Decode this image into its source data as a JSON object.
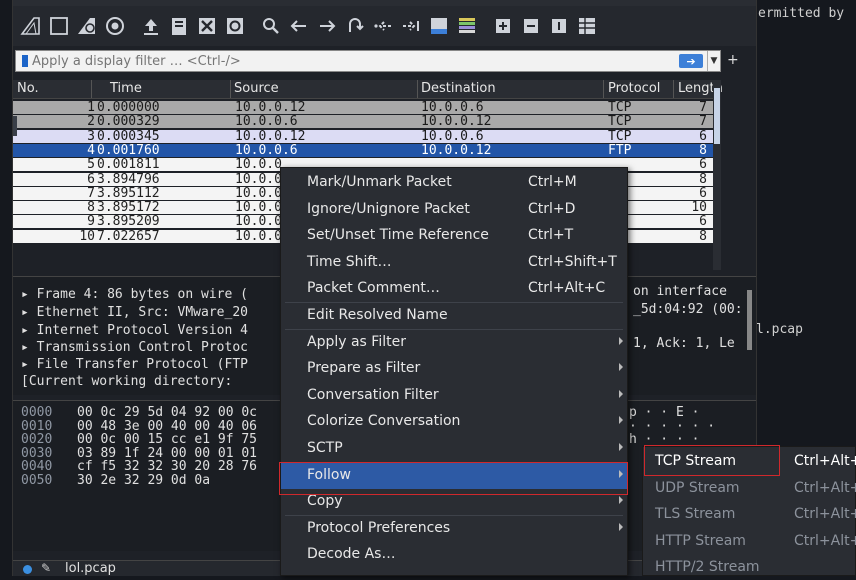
{
  "window": {
    "file_name": "lol.pcap"
  },
  "background_text": {
    "right_top": "ermitted by",
    "right_mid": "l.pcap"
  },
  "toolbar": {
    "icons": [
      "shark-fin-icon",
      "stop-icon",
      "restart-icon",
      "options-gear-icon",
      "open-file-icon",
      "save-file-icon",
      "close-file-icon",
      "reload-icon",
      "search-icon",
      "back-arrow-icon",
      "forward-arrow-icon",
      "go-to-packet-icon",
      "first-packet-icon",
      "last-packet-icon",
      "autoscroll-icon",
      "colorize-icon",
      "zoom-in-icon",
      "zoom-out-icon",
      "normal-size-icon",
      "resize-columns-icon"
    ]
  },
  "filter": {
    "placeholder": "Apply a display filter … <Ctrl-/>"
  },
  "columns": {
    "no": "No.",
    "time": "Time",
    "source": "Source",
    "destination": "Destination",
    "protocol": "Protocol",
    "length": "Length"
  },
  "packets": [
    {
      "no": "1",
      "time": "0.000000",
      "src": "10.0.0.12",
      "dst": "10.0.0.6",
      "proto": "TCP",
      "len": "7",
      "style": "gray"
    },
    {
      "no": "2",
      "time": "0.000329",
      "src": "10.0.0.6",
      "dst": "10.0.0.12",
      "proto": "TCP",
      "len": "7",
      "style": "gray"
    },
    {
      "no": "3",
      "time": "0.000345",
      "src": "10.0.0.12",
      "dst": "10.0.0.6",
      "proto": "TCP",
      "len": "6",
      "style": "lav"
    },
    {
      "no": "4",
      "time": "0.001760",
      "src": "10.0.0.6",
      "dst": "10.0.0.12",
      "proto": "FTP",
      "len": "8",
      "style": "sel"
    },
    {
      "no": "5",
      "time": "0.001811",
      "src": "10.0.0",
      "dst": "",
      "proto": "",
      "len": "6",
      "style": "plain"
    },
    {
      "no": "6",
      "time": "3.894796",
      "src": "10.0.0",
      "dst": "",
      "proto": "",
      "len": "8",
      "style": "plain"
    },
    {
      "no": "7",
      "time": "3.895112",
      "src": "10.0.0",
      "dst": "",
      "proto": "",
      "len": "6",
      "style": "plain"
    },
    {
      "no": "8",
      "time": "3.895172",
      "src": "10.0.0",
      "dst": "",
      "proto": "",
      "len": "10",
      "style": "plain"
    },
    {
      "no": "9",
      "time": "3.895209",
      "src": "10.0.0",
      "dst": "",
      "proto": "",
      "len": "6",
      "style": "plain"
    },
    {
      "no": "10",
      "time": "7.022657",
      "src": "10.0.0",
      "dst": "",
      "proto": "",
      "len": "8",
      "style": "plain"
    }
  ],
  "details": {
    "lines": [
      "▸ Frame 4: 86 bytes on wire (",
      "▸ Ethernet II, Src: VMware_20",
      "▸ Internet Protocol Version 4",
      "▸ Transmission Control Protoc",
      "▸ File Transfer Protocol (FTP",
      "  [Current working directory:"
    ],
    "right": [
      "on interface",
      "_5d:04:92 (00:",
      "",
      "1, Ack: 1, Le"
    ]
  },
  "hex": {
    "offsets": [
      "0000",
      "0010",
      "0020",
      "0030",
      "0040",
      "0050"
    ],
    "bytes": [
      "00 0c 29 5d 04 92 00 0c",
      "00 48 3e 00 40 00 40 06",
      "00 0c 00 15 cc e1 9f 75",
      "03 89 1f 24 00 00 01 01",
      "cf f5 32 32 30 20 28 76",
      "30 2e 32 29 0d 0a"
    ],
    "ascii": [
      "p · · E ·",
      "· · · · · ·",
      "h · · · ·"
    ]
  },
  "context_menu": {
    "items": [
      {
        "label": "Mark/Unmark Packet",
        "shortcut": "Ctrl+M",
        "submenu": false
      },
      {
        "label": "Ignore/Unignore Packet",
        "shortcut": "Ctrl+D",
        "submenu": false
      },
      {
        "label": "Set/Unset Time Reference",
        "shortcut": "Ctrl+T",
        "submenu": false
      },
      {
        "label": "Time Shift…",
        "shortcut": "Ctrl+Shift+T",
        "submenu": false
      },
      {
        "label": "Packet Comment…",
        "shortcut": "Ctrl+Alt+C",
        "submenu": false
      },
      {
        "label": "Edit Resolved Name",
        "shortcut": "",
        "submenu": false
      },
      {
        "label": "Apply as Filter",
        "shortcut": "",
        "submenu": true
      },
      {
        "label": "Prepare as Filter",
        "shortcut": "",
        "submenu": true
      },
      {
        "label": "Conversation Filter",
        "shortcut": "",
        "submenu": true
      },
      {
        "label": "Colorize Conversation",
        "shortcut": "",
        "submenu": true
      },
      {
        "label": "SCTP",
        "shortcut": "",
        "submenu": true
      },
      {
        "label": "Follow",
        "shortcut": "",
        "submenu": true
      },
      {
        "label": "Copy",
        "shortcut": "",
        "submenu": true
      },
      {
        "label": "Protocol Preferences",
        "shortcut": "",
        "submenu": true
      },
      {
        "label": "Decode As…",
        "shortcut": "",
        "submenu": false
      }
    ],
    "highlighted": "Follow"
  },
  "follow_submenu": {
    "items": [
      {
        "label": "TCP Stream",
        "shortcut": "Ctrl+Alt+",
        "enabled": true
      },
      {
        "label": "UDP Stream",
        "shortcut": "Ctrl+Alt+",
        "enabled": false
      },
      {
        "label": "TLS Stream",
        "shortcut": "Ctrl+Alt+",
        "enabled": false
      },
      {
        "label": "HTTP Stream",
        "shortcut": "Ctrl+Alt+",
        "enabled": false
      },
      {
        "label": "HTTP/2 Stream",
        "shortcut": "",
        "enabled": false
      }
    ]
  },
  "colors": {
    "selected_row": "#2255a8",
    "menu_highlight": "#2d5aa5",
    "annotation_box": "#d0282c"
  }
}
